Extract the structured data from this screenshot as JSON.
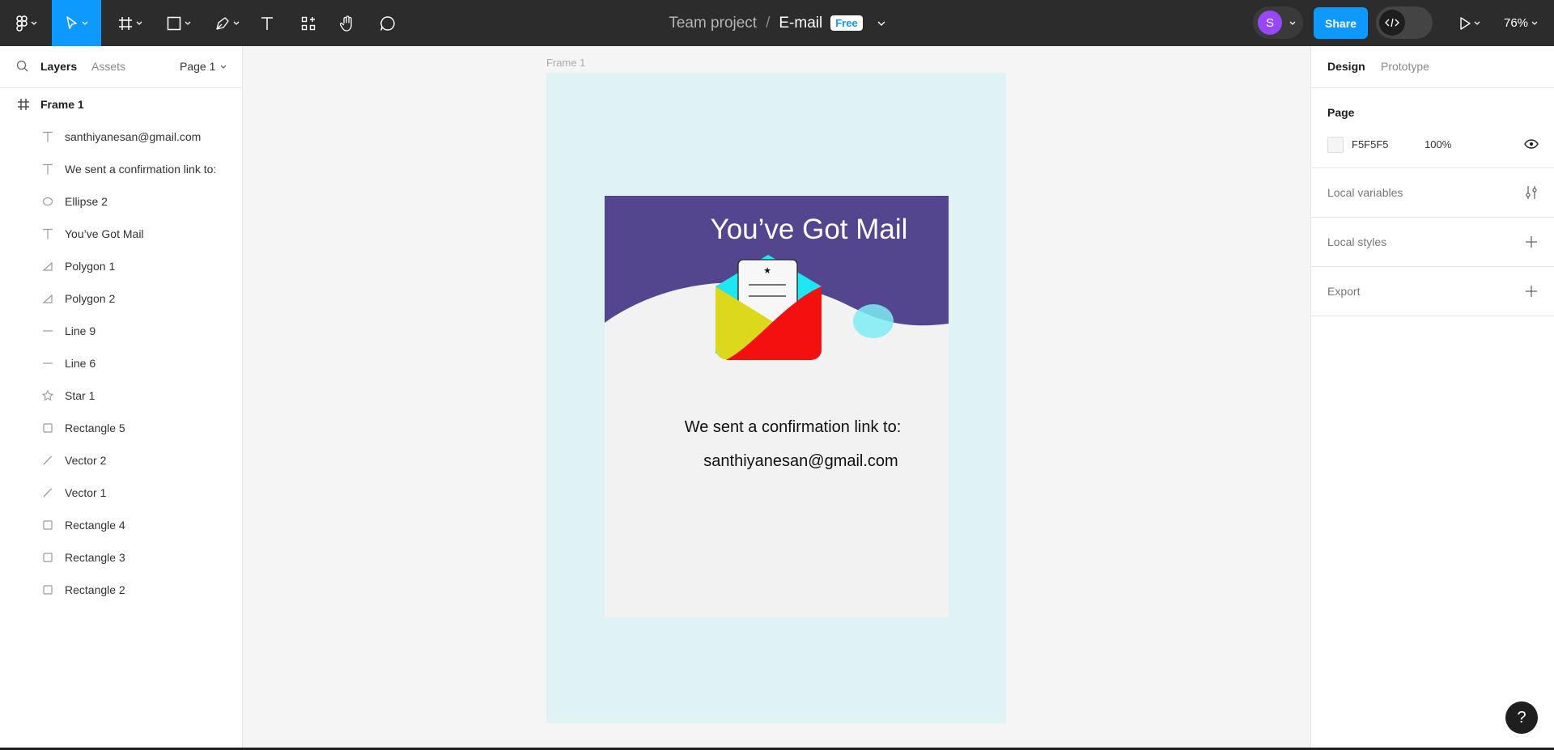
{
  "toolbar": {
    "breadcrumb_team": "Team project",
    "breadcrumb_sep": "/",
    "file_name": "E-mail",
    "plan_badge": "Free",
    "avatar_initial": "S",
    "share_label": "Share",
    "zoom": "76%"
  },
  "left_panel": {
    "tabs": {
      "layers": "Layers",
      "assets": "Assets"
    },
    "page_select": "Page 1",
    "layers": [
      {
        "name": "Frame 1",
        "icon": "frame-icon"
      },
      {
        "name": "santhiyanesan@gmail.com",
        "icon": "text-icon"
      },
      {
        "name": "We sent a confirmation link to:",
        "icon": "text-icon"
      },
      {
        "name": "Ellipse 2",
        "icon": "ellipse-icon"
      },
      {
        "name": "You’ve Got Mail",
        "icon": "text-icon"
      },
      {
        "name": "Polygon 1",
        "icon": "polygon-icon"
      },
      {
        "name": "Polygon 2",
        "icon": "polygon-icon"
      },
      {
        "name": "Line 9",
        "icon": "line-icon"
      },
      {
        "name": "Line 6",
        "icon": "line-icon"
      },
      {
        "name": "Star 1",
        "icon": "star-icon"
      },
      {
        "name": "Rectangle 5",
        "icon": "rectangle-icon"
      },
      {
        "name": "Vector 2",
        "icon": "vector-icon"
      },
      {
        "name": "Vector 1",
        "icon": "vector-icon"
      },
      {
        "name": "Rectangle 4",
        "icon": "rectangle-icon"
      },
      {
        "name": "Rectangle 3",
        "icon": "rectangle-icon"
      },
      {
        "name": "Rectangle 2",
        "icon": "rectangle-icon"
      }
    ]
  },
  "canvas": {
    "frame_label": "Frame 1",
    "email": {
      "title": "You’ve Got Mail",
      "line1": "We sent a confirmation link to:",
      "line2": "santhiyanesan@gmail.com",
      "colors": {
        "header": "#54468e",
        "body": "#f2f2f2",
        "envelope_red": "#f51010",
        "envelope_yellow": "#dcd81c",
        "envelope_cyan": "#1ee6f2",
        "bubble": "#7eecf3",
        "frame_bg": "#dff3f4"
      }
    }
  },
  "right_panel": {
    "tabs": {
      "design": "Design",
      "prototype": "Prototype"
    },
    "page_section": {
      "title": "Page",
      "color_hex": "F5F5F5",
      "opacity": "100%"
    },
    "sections": [
      "Local variables",
      "Local styles",
      "Export"
    ]
  },
  "help": "?"
}
